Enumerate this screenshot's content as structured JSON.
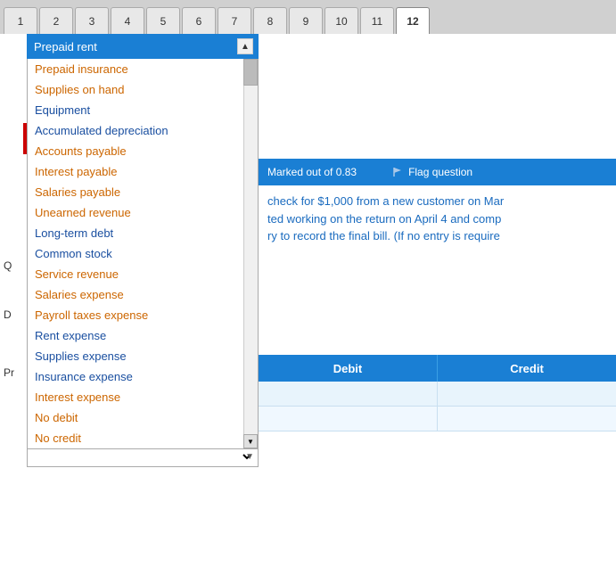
{
  "tabs": {
    "items": [
      {
        "label": "1",
        "active": false
      },
      {
        "label": "2",
        "active": false
      },
      {
        "label": "3",
        "active": false
      },
      {
        "label": "4",
        "active": false
      },
      {
        "label": "5",
        "active": false
      },
      {
        "label": "6",
        "active": false
      },
      {
        "label": "7",
        "active": false
      },
      {
        "label": "8",
        "active": false
      },
      {
        "label": "9",
        "active": false
      },
      {
        "label": "10",
        "active": false
      },
      {
        "label": "11",
        "active": false
      },
      {
        "label": "12",
        "active": true
      }
    ]
  },
  "question_meta": {
    "marked": "Marked out of 0.83",
    "flag": "Flag question"
  },
  "question_text": {
    "line1": "check for $1,000 from a new customer on Mar",
    "line2": "ted working on the return on April 4 and comp",
    "line3": "ry to record the final bill.  (If no entry is require"
  },
  "table": {
    "headers": [
      "Debit",
      "Credit"
    ],
    "rows": [
      {
        "debit": "",
        "credit": ""
      },
      {
        "debit": "",
        "credit": ""
      }
    ]
  },
  "dropdown": {
    "selected": "Prepaid rent",
    "items": [
      {
        "label": "Prepaid insurance",
        "color": "orange"
      },
      {
        "label": "Supplies on hand",
        "color": "orange"
      },
      {
        "label": "Equipment",
        "color": "blue"
      },
      {
        "label": "Accumulated depreciation",
        "color": "blue"
      },
      {
        "label": "Accounts payable",
        "color": "orange"
      },
      {
        "label": "Interest payable",
        "color": "orange"
      },
      {
        "label": "Salaries payable",
        "color": "orange"
      },
      {
        "label": "Unearned revenue",
        "color": "orange"
      },
      {
        "label": "Long-term debt",
        "color": "blue"
      },
      {
        "label": "Common stock",
        "color": "blue"
      },
      {
        "label": "Service revenue",
        "color": "orange"
      },
      {
        "label": "Salaries expense",
        "color": "orange"
      },
      {
        "label": "Payroll taxes expense",
        "color": "orange"
      },
      {
        "label": "Rent expense",
        "color": "blue"
      },
      {
        "label": "Supplies expense",
        "color": "blue"
      },
      {
        "label": "Insurance expense",
        "color": "blue"
      },
      {
        "label": "Interest expense",
        "color": "orange"
      },
      {
        "label": "No debit",
        "color": "orange"
      },
      {
        "label": "No credit",
        "color": "orange"
      }
    ]
  },
  "labels": {
    "q": "Q",
    "d": "D",
    "pr": "Pr"
  }
}
